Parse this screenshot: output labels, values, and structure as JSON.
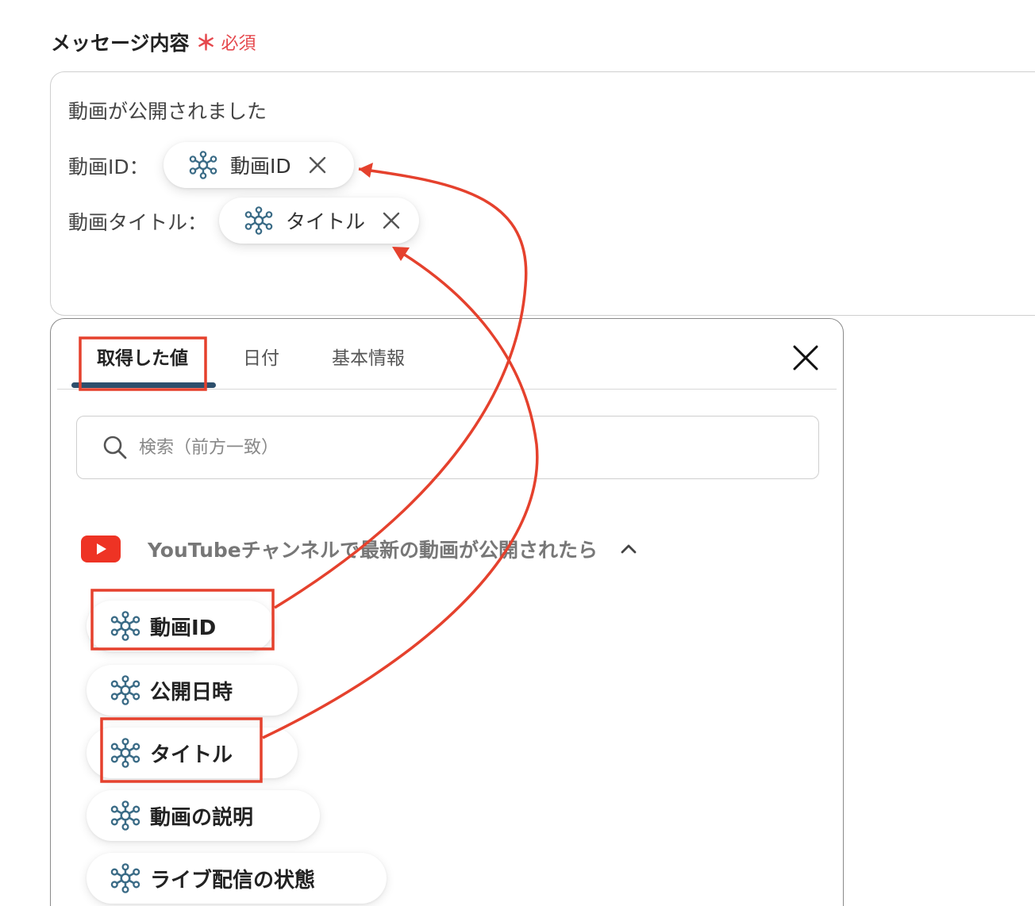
{
  "field": {
    "label": "メッセージ内容",
    "required_mark": "＊",
    "required_text": "必須"
  },
  "message": {
    "line1": "動画が公開されました",
    "line2_prefix": "動画ID：",
    "line3_prefix": "動画タイトル：",
    "var_id_label": "動画ID",
    "var_title_label": "タイトル"
  },
  "panel": {
    "tabs": [
      {
        "label": "取得した値",
        "active": true
      },
      {
        "label": "日付",
        "active": false
      },
      {
        "label": "基本情報",
        "active": false
      }
    ],
    "search_placeholder": "検索（前方一致）",
    "section_title": "YouTubeチャンネルで最新の動画が公開されたら",
    "items": [
      {
        "label": "動画ID"
      },
      {
        "label": "公開日時"
      },
      {
        "label": "タイトル"
      },
      {
        "label": "動画の説明"
      },
      {
        "label": "ライブ配信の状態"
      }
    ]
  },
  "icons": {
    "variable": "network-node-icon",
    "remove": "close-x-icon",
    "close_panel": "close-x-icon",
    "search": "search-icon",
    "section": "youtube-icon",
    "collapse": "chevron-up-icon"
  },
  "colors": {
    "required": "#e5484d",
    "tab_active_underline": "#2d4f6c",
    "node_icon": "#3a6b86",
    "annotation": "#e5412d",
    "youtube": "#ee3324"
  }
}
